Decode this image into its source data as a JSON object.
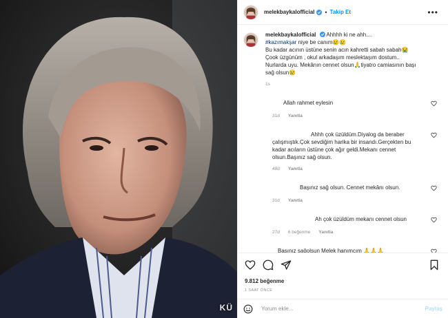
{
  "post": {
    "username": "melekbaykalofficial",
    "follow_label": "Takip Et",
    "more_label": "•••",
    "photo_caption": "KÜ"
  },
  "caption": {
    "username": "melekbaykalofficial",
    "line1": "Ahhhh ki ne ahh....",
    "hashtag": "#kazımakşar",
    "line2": "niye be canım😢😢",
    "line3": "Bu kadar acının üstüne senin acın kahretti sabah sabah😭",
    "line4": "Çook üzgünüm , okul arkadaşım meslektaşım dostum..",
    "line5": "Nurlarda uyu. Mekânın cennet olsun🙏tiyatro camiasının başı",
    "line6": "sağ olsun😢",
    "time": "1s"
  },
  "comments": [
    {
      "text": "Allah rahmet eylesin",
      "time": "31d",
      "likes": "",
      "reply": "Yanıtla"
    },
    {
      "text": "Ahhh çok üzüldüm.Diyalog da beraber çalışmıştık.Çok sevdiğim harika bir insandı.Gerçekten bu kadar acıların üstüne çok ağır geldi.Mekanı cennet olsun.Başınız sağ olsun.",
      "time": "48d",
      "likes": "",
      "reply": "Yanıtla"
    },
    {
      "text": "Başınız sağ olsun. Cennet mekânı olsun.",
      "time": "31d",
      "likes": "",
      "reply": "Yanıtla"
    },
    {
      "text": "Ah çok üzüldüm mekanı cennet olsun",
      "time": "27d",
      "likes": "6 beğenme",
      "reply": "Yanıtla"
    },
    {
      "text": "Başınız sağolsun Melek hanımcım 🙏🙏🙏",
      "time": "",
      "likes": "",
      "reply": ""
    }
  ],
  "stats": {
    "likes": "9.812 beğenme",
    "posted": "1 SAAT ÖNCE"
  },
  "composer": {
    "placeholder": "Yorum ekle...",
    "share_label": "Paylaş"
  },
  "icons": {
    "heart": "heart-icon",
    "comment": "comment-icon",
    "share": "send-icon",
    "save": "bookmark-icon",
    "emoji": "emoji-icon",
    "verified": "verified-badge-icon",
    "verified_color": "#3897f0",
    "follow_color": "#0095f6"
  }
}
